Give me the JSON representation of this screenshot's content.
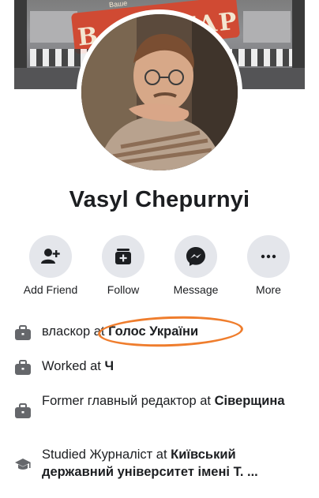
{
  "cover": {
    "sign_text": "В ФОНТАР",
    "small_text": "Ваше"
  },
  "profile": {
    "name": "Vasyl Chepurnyi"
  },
  "actions": [
    {
      "label": "Add Friend",
      "icon": "add-friend-icon"
    },
    {
      "label": "Follow",
      "icon": "follow-icon"
    },
    {
      "label": "Message",
      "icon": "messenger-icon"
    },
    {
      "label": "More",
      "icon": "more-icon"
    }
  ],
  "info": {
    "work1": {
      "prefix": "власкор at ",
      "place": "Голос України",
      "icon": "briefcase-icon"
    },
    "work2": {
      "prefix": "Worked at ",
      "place": "Ч",
      "icon": "briefcase-icon"
    },
    "work3": {
      "prefix": "Former главный редактор at ",
      "place": "Сіверщина",
      "icon": "briefcase-icon"
    },
    "education": {
      "prefix": "Studied Журналіст at ",
      "place": "Київський державний університет імені Т. ...",
      "icon": "graduation-cap-icon"
    }
  },
  "colors": {
    "highlight": "#ef7d2d",
    "button_bg": "#e4e6eb",
    "text": "#1c1e21",
    "icon": "#65676b"
  }
}
